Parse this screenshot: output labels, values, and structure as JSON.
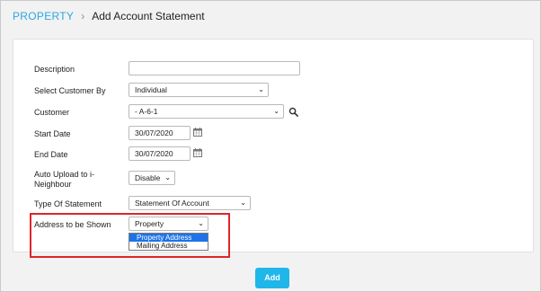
{
  "breadcrumb": {
    "root": "PROPERTY",
    "separator": "›",
    "current": "Add Account Statement"
  },
  "form": {
    "description": {
      "label": "Description",
      "value": ""
    },
    "select_customer_by": {
      "label": "Select Customer By",
      "value": "Individual"
    },
    "customer": {
      "label": "Customer",
      "value": "- A-6-1"
    },
    "start_date": {
      "label": "Start Date",
      "value": "30/07/2020"
    },
    "end_date": {
      "label": "End Date",
      "value": "30/07/2020"
    },
    "auto_upload": {
      "label_line1": "Auto Upload to i-",
      "label_line2": "Neighbour",
      "value": "Disable"
    },
    "type_of_statement": {
      "label": "Type Of Statement",
      "value": "Statement Of Account"
    },
    "address_to_be_shown": {
      "label": "Address to be Shown",
      "value": "Property Address",
      "options": [
        "Property Address",
        "Mailing Address"
      ],
      "highlighted_option": "Property Address"
    }
  },
  "actions": {
    "add_label": "Add"
  },
  "colors": {
    "accent": "#2aa7e0",
    "button": "#1fb6ea",
    "highlight_box": "#e0242a",
    "selected_option": "#1e73e8"
  },
  "icons": {
    "calendar": "calendar-icon",
    "search": "search-icon",
    "caret": "chevron-down-icon"
  }
}
